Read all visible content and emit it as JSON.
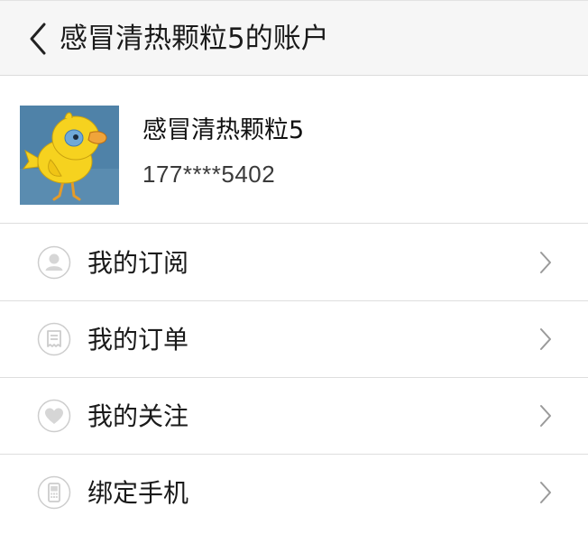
{
  "header": {
    "title": "感冒清热颗粒5的账户",
    "back_icon": "chevron-left-icon"
  },
  "profile": {
    "name": "感冒清热颗粒5",
    "phone": "177****5402",
    "avatar": "cartoon-yellow-bird-avatar"
  },
  "menu": {
    "items": [
      {
        "label": "我的订阅",
        "icon": "user-icon"
      },
      {
        "label": "我的订单",
        "icon": "receipt-icon"
      },
      {
        "label": "我的关注",
        "icon": "heart-icon"
      },
      {
        "label": "绑定手机",
        "icon": "mobile-phone-icon"
      }
    ],
    "chevron_icon": "chevron-right-icon"
  },
  "colors": {
    "header_bg": "#f6f6f6",
    "divider": "#dedede",
    "icon_gray": "#c9c9c9",
    "chevron_gray": "#9a9a9a",
    "avatar_bg": "#4f82a8",
    "bird_yellow": "#f6d21f"
  }
}
